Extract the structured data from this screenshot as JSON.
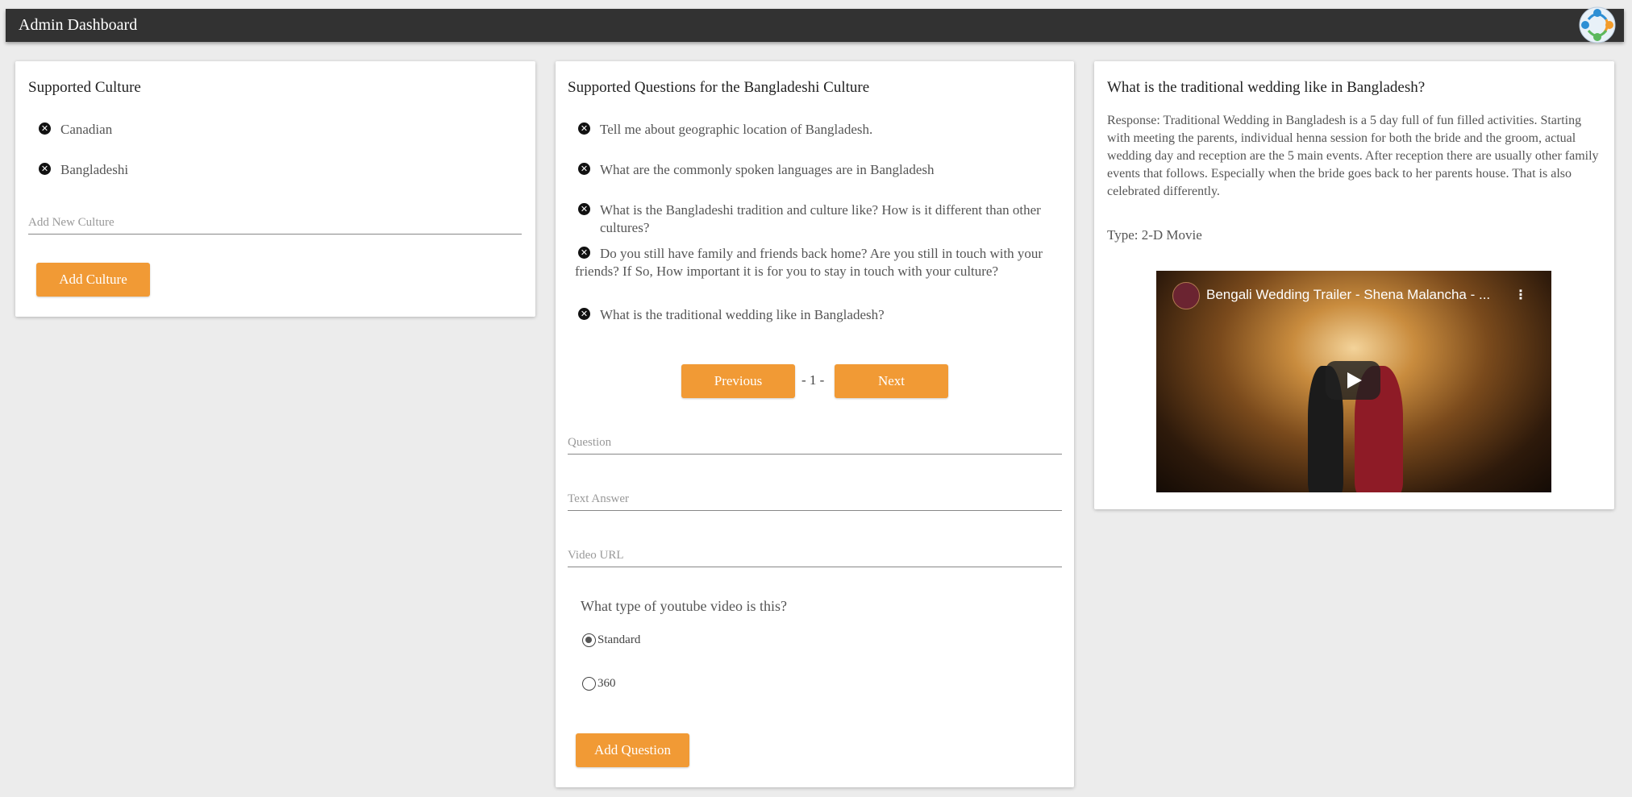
{
  "header": {
    "title": "Admin Dashboard"
  },
  "cultures": {
    "title": "Supported Culture",
    "items": [
      "Canadian",
      "Bangladeshi"
    ],
    "input_placeholder": "Add New Culture",
    "add_button": "Add Culture"
  },
  "questions": {
    "title": "Supported Questions for the Bangladeshi Culture",
    "items": [
      "Tell me about geographic location of Bangladesh.",
      "What are the commonly spoken languages are in Bangladesh",
      "What is the Bangladeshi tradition and culture like? How is it different than other cultures?",
      "Do you still have family and friends back home? Are you still in touch with your friends? If So, How important it is for you to stay in touch with your culture?",
      "What is the traditional wedding like in Bangladesh?"
    ],
    "pagination": {
      "previous": "Previous",
      "page": "- 1 -",
      "next": "Next"
    },
    "question_placeholder": "Question",
    "answer_placeholder": "Text Answer",
    "video_placeholder": "Video URL",
    "video_type_label": "What type of youtube video is this?",
    "video_types": [
      {
        "label": "Standard",
        "checked": true
      },
      {
        "label": "360",
        "checked": false
      }
    ],
    "add_button": "Add Question"
  },
  "detail": {
    "title": "What is the traditional wedding like in Bangladesh?",
    "response": "Response: Traditional Wedding in Bangladesh is a 5 day full of fun filled activities. Starting with meeting the parents, individual henna session for both the bride and the groom, actual wedding day and reception are the 5 main events. After reception there are usually other family events that follows. Especially when the bride goes back to her parents house. That is also celebrated differently.",
    "type": "Type: 2-D Movie",
    "video_title": "Bengali Wedding Trailer - Shena Malancha - ..."
  },
  "icons": {
    "remove": "close-circle-icon",
    "play": "play-icon",
    "menu": "more-vertical-icon",
    "logo": "people-circle-logo"
  },
  "colors": {
    "topbar": "#323232",
    "accent": "#f19a35",
    "background": "#ececec"
  }
}
